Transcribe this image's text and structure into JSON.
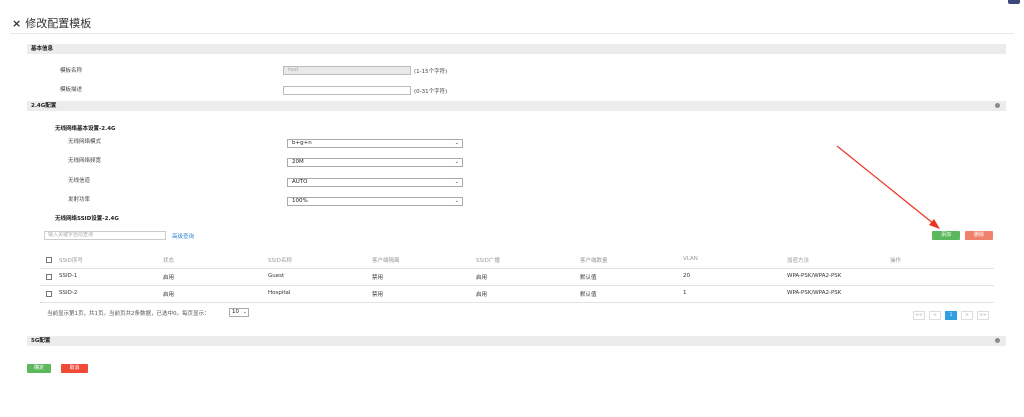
{
  "header": {
    "close_glyph": "×",
    "title": "修改配置模板"
  },
  "basic": {
    "section_title": "基本信息",
    "name_label": "模板名称",
    "name_value": "test",
    "name_hint": "(1-15个字符)",
    "desc_label": "模板描述",
    "desc_value": "",
    "desc_hint": "(0-31个字符)"
  },
  "g24": {
    "section_title": "2.4G配置",
    "basic_sub": "无线网络基本设置-2.4G",
    "mode_label": "无线网络模式",
    "mode_value": "b+g+n",
    "bandwidth_label": "无线网络频宽",
    "bandwidth_value": "20M",
    "channel_label": "无线信道",
    "channel_value": "AUTO",
    "power_label": "发射功率",
    "power_value": "100%",
    "ssid_sub": "无线网络SSID设置-2.4G",
    "search_placeholder": "输入关键字自动查询",
    "advanced_search": "高级查询",
    "add_button": "添加",
    "delete_button": "删除",
    "table": {
      "headers": [
        "SSID序号",
        "状态",
        "SSID名称",
        "客户端隔离",
        "SSID广播",
        "客户端数量",
        "VLAN",
        "加密方法",
        "操作"
      ],
      "rows": [
        [
          "SSID-1",
          "启用",
          "Guest",
          "禁用",
          "启用",
          "默认值",
          "20",
          "WPA-PSK/WPA2-PSK",
          ""
        ],
        [
          "SSID-2",
          "启用",
          "Hospital",
          "禁用",
          "启用",
          "默认值",
          "1",
          "WPA-PSK/WPA2-PSK",
          ""
        ]
      ]
    },
    "pagination_text": "当前显示第1页，共1页。当前页共2条数据，已选中0。每页显示：",
    "page_size": "10",
    "pager": [
      "<<",
      "<",
      "1",
      ">",
      ">>"
    ]
  },
  "g5": {
    "section_title": "5G配置"
  },
  "footer": {
    "confirm_button": "确定",
    "cancel_button": "取消"
  },
  "colors": {
    "green": "#5cb85c",
    "red": "#ef4b36",
    "link": "#2f7fd1",
    "arrow": "#ee3322"
  }
}
